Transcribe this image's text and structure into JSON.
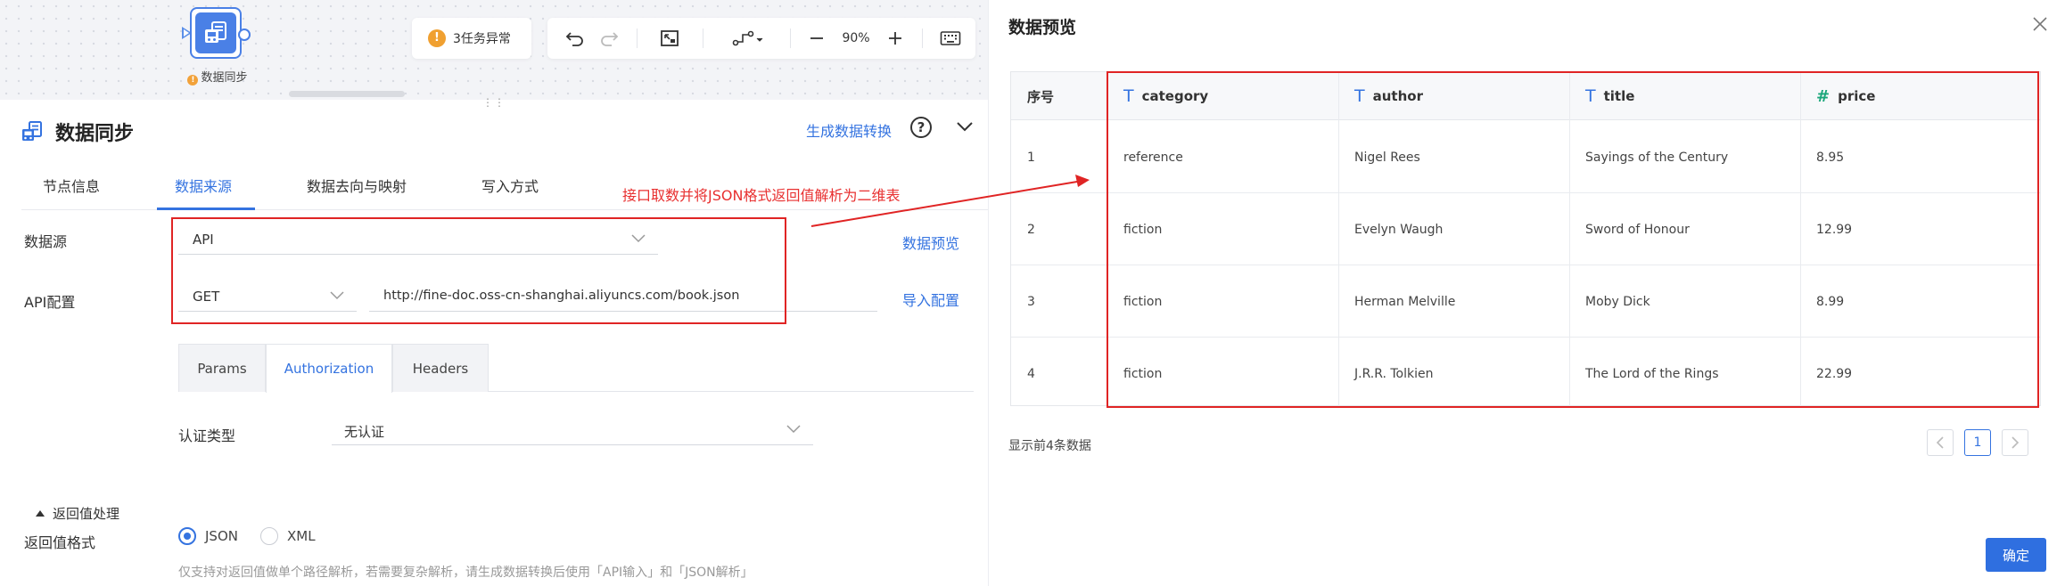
{
  "canvas": {
    "node_label": "数据同步",
    "alert_text": "3任务异常",
    "zoom": "90%"
  },
  "panel": {
    "title": "数据同步",
    "generate_link": "生成数据转换",
    "tabs": [
      "节点信息",
      "数据来源",
      "数据去向与映射",
      "写入方式"
    ],
    "active_tab": "数据来源",
    "annotation": "接口取数并将JSON格式返回值解析为二维表",
    "datasource_label": "数据源",
    "datasource_value": "API",
    "preview_link": "数据预览",
    "api_label": "API配置",
    "method_value": "GET",
    "url_value": "http://fine-doc.oss-cn-shanghai.aliyuncs.com/book.json",
    "import_link": "导入配置",
    "subtabs": [
      "Params",
      "Authorization",
      "Headers"
    ],
    "active_subtab": "Authorization",
    "auth_label": "认证类型",
    "auth_value": "无认证",
    "section_toggle": "返回值处理",
    "format_label": "返回值格式",
    "format_options": [
      "JSON",
      "XML"
    ],
    "format_selected": "JSON",
    "hint": "仅支持对返回值做单个路径解析，若需要复杂解析，请生成数据转换后使用「API输入」和「JSON解析」"
  },
  "preview": {
    "title": "数据预览",
    "columns": [
      {
        "label": "序号",
        "type": ""
      },
      {
        "label": "category",
        "type": "text"
      },
      {
        "label": "author",
        "type": "text"
      },
      {
        "label": "title",
        "type": "text"
      },
      {
        "label": "price",
        "type": "number"
      }
    ],
    "rows": [
      [
        "1",
        "reference",
        "Nigel Rees",
        "Sayings of the Century",
        "8.95"
      ],
      [
        "2",
        "fiction",
        "Evelyn Waugh",
        "Sword of Honour",
        "12.99"
      ],
      [
        "3",
        "fiction",
        "Herman Melville",
        "Moby Dick",
        "8.99"
      ],
      [
        "4",
        "fiction",
        "J.R.R. Tolkien",
        "The Lord of the Rings",
        "22.99"
      ]
    ],
    "count_text": "显示前4条数据",
    "current_page": "1",
    "confirm_label": "确定"
  },
  "colors": {
    "accent": "#3473e0",
    "annotation_red": "#e02424",
    "warning": "#f0a030"
  }
}
